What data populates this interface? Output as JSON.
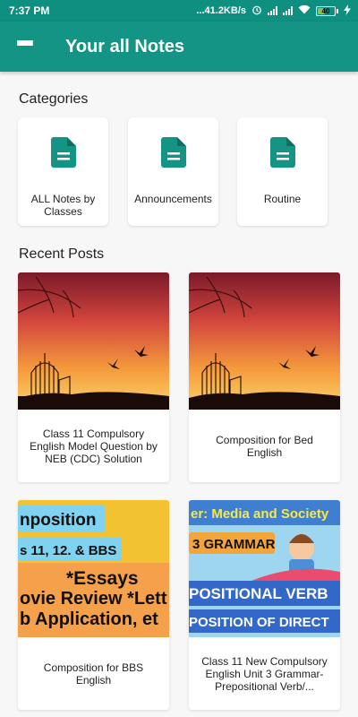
{
  "status_bar": {
    "time": "7:37 PM",
    "network_speed": "...41.2KB/s",
    "battery_level": "40",
    "icons": [
      "alarm-icon",
      "signal-icon",
      "wifi-icon",
      "battery-icon",
      "charging-icon"
    ]
  },
  "app_bar": {
    "title": "Your all Notes",
    "menu_icon": "menu-icon",
    "color": "#139484"
  },
  "categories": {
    "title": "Categories",
    "items": [
      {
        "label": "ALL Notes by Classes",
        "icon": "document-icon"
      },
      {
        "label": "Announcements",
        "icon": "document-icon"
      },
      {
        "label": "Routine",
        "icon": "document-icon"
      }
    ]
  },
  "recent_posts": {
    "title": "Recent Posts",
    "items": [
      {
        "title": "Class 11 Compulsory English Model Question by NEB (CDC) Solution",
        "thumbnail": "sunset-birdcage"
      },
      {
        "title": "Composition for Bed English",
        "thumbnail": "sunset-birdcage"
      },
      {
        "title": "Composition for BBS English",
        "thumbnail": "composition-banner",
        "thumb_text": [
          "nposition",
          "s 11, 12. & BBS",
          "*Essays",
          "ovie Review *Lett",
          "b Application, et"
        ]
      },
      {
        "title": "Class 11 New Compulsory English  Unit 3 Grammar- Prepositional Verb/...",
        "thumbnail": "grammar-banner",
        "thumb_text": [
          "er: Media and Society",
          "3 GRAMMAR",
          "POSITIONAL VERB",
          "POSITION OF DIRECT"
        ]
      }
    ]
  },
  "colors": {
    "accent": "#139484",
    "status_bar": "#0e8f80"
  }
}
